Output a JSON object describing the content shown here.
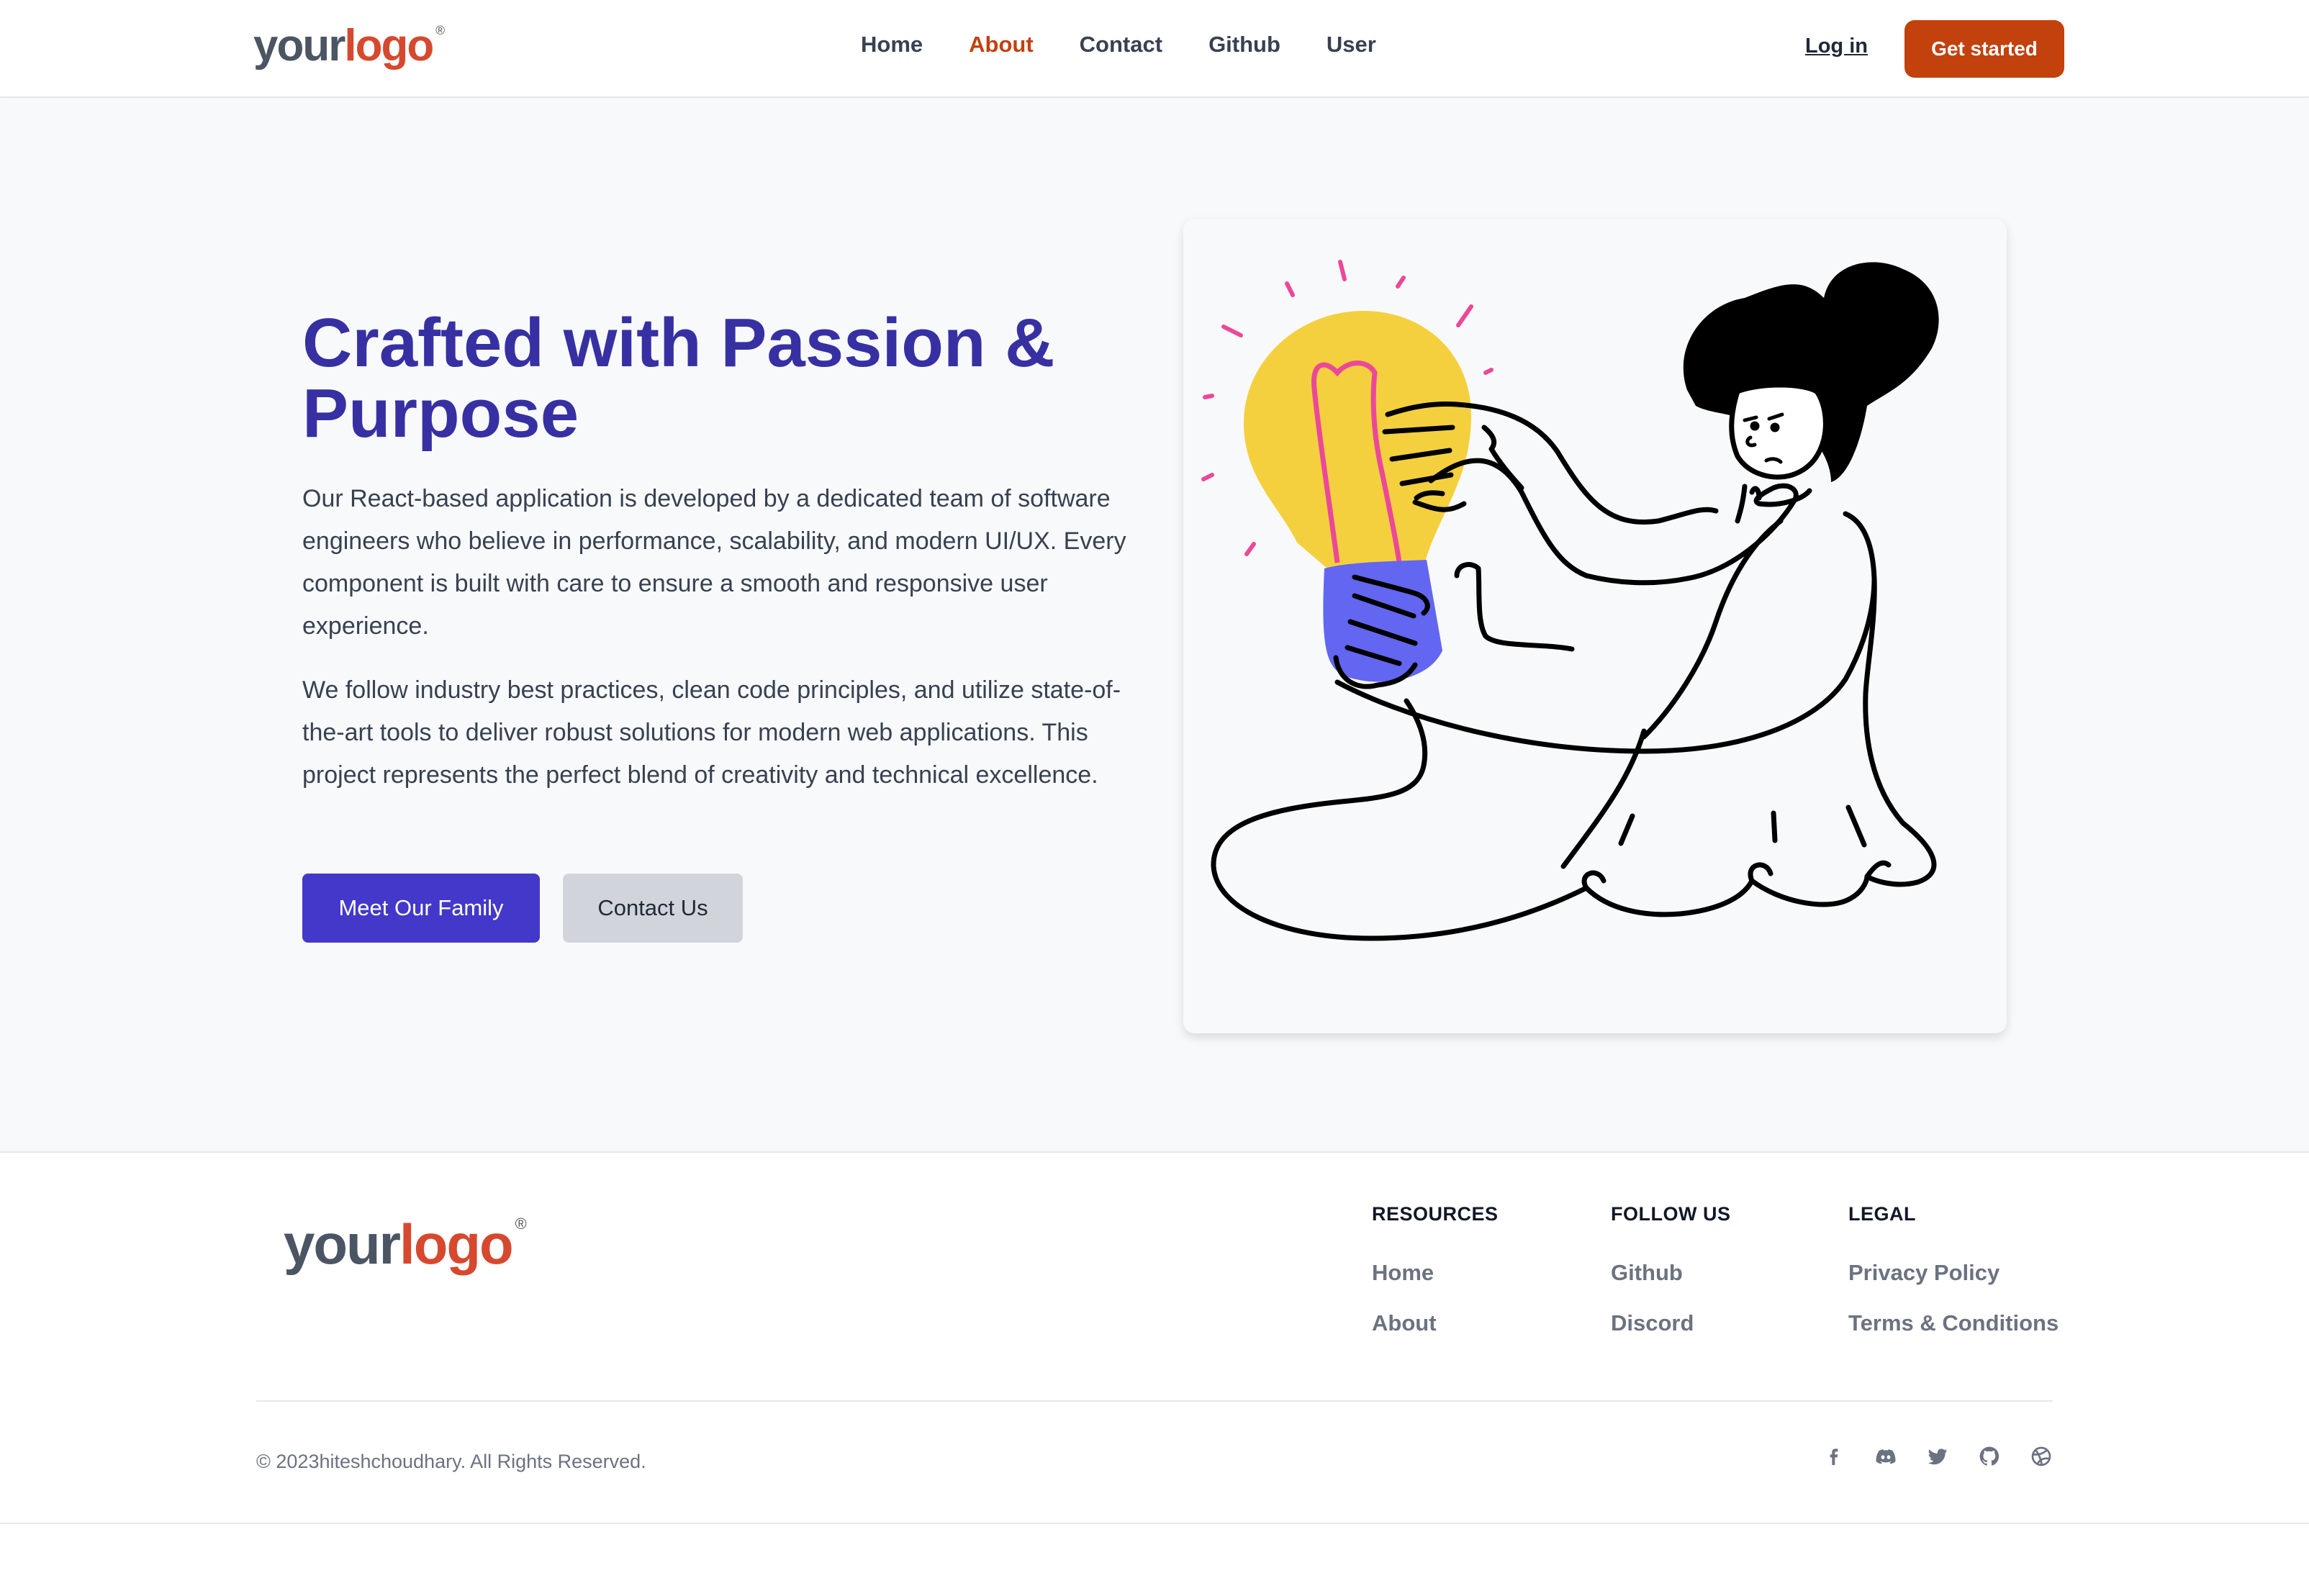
{
  "header": {
    "logo": {
      "text_your": "your",
      "text_logo": "logo",
      "reg": "®"
    },
    "nav": [
      "Home",
      "About",
      "Contact",
      "Github",
      "User"
    ],
    "active_nav": "About",
    "login_label": "Log in",
    "cta_label": "Get started"
  },
  "hero": {
    "title": "Crafted with Passion & Purpose",
    "paragraph1": "Our React-based application is developed by a dedicated team of software engineers who believe in performance, scalability, and modern UI/UX. Every component is built with care to ensure a smooth and responsive user experience.",
    "paragraph2": "We follow industry best practices, clean code principles, and utilize state-of-the-art tools to deliver robust solutions for modern web applications. This project represents the perfect blend of creativity and technical excellence.",
    "primary_button": "Meet Our Family",
    "secondary_button": "Contact Us",
    "illustration_icon": "person-holding-lightbulb-illustration"
  },
  "footer": {
    "logo": {
      "text_your": "your",
      "text_logo": "logo",
      "reg": "®"
    },
    "columns": [
      {
        "heading": "RESOURCES",
        "links": [
          "Home",
          "About"
        ]
      },
      {
        "heading": "FOLLOW US",
        "links": [
          "Github",
          "Discord"
        ]
      },
      {
        "heading": "LEGAL",
        "links": [
          "Privacy Policy",
          "Terms & Conditions"
        ]
      }
    ],
    "copyright": "© 2023hiteshchoudhary. All Rights Reserved.",
    "social_icons": [
      "facebook-icon",
      "discord-icon",
      "twitter-icon",
      "github-icon",
      "dribbble-icon"
    ]
  },
  "colors": {
    "brand_accent": "#c2410c",
    "hero_title": "#3730a3",
    "primary_button": "#4338ca",
    "logo_accent": "#d6492f",
    "bulb_yellow": "#f4d03f",
    "bulb_base": "#6366f1",
    "filament_pink": "#f472b6"
  }
}
